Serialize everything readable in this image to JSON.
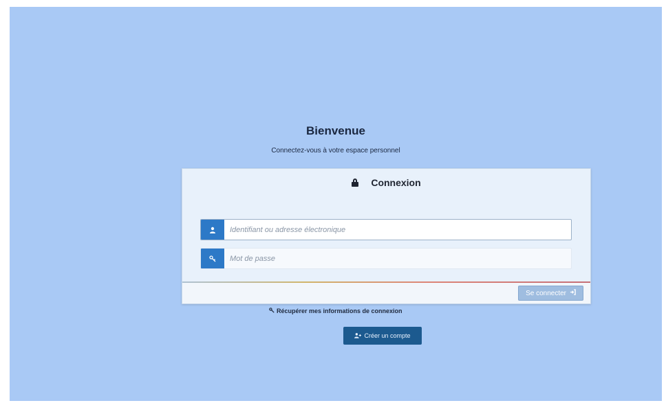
{
  "header": {
    "title": "Bienvenue",
    "subtitle": "Connectez-vous à votre espace personnel"
  },
  "panel": {
    "title": "Connexion",
    "title_icon": "lock-icon",
    "username": {
      "icon": "user-icon",
      "placeholder": "Identifiant ou adresse électronique",
      "value": ""
    },
    "password": {
      "icon": "key-icon",
      "placeholder": "Mot de passe",
      "value": ""
    },
    "login_button": {
      "label": "Se connecter",
      "icon": "sign-in-icon"
    }
  },
  "recover_link": {
    "label": "Récupérer mes informations de connexion",
    "icon": "key-icon"
  },
  "create_account_button": {
    "label": "Créer un compte",
    "icon": "user-plus-icon"
  },
  "colors": {
    "background": "#a9c9f5",
    "accent": "#2d79c7",
    "create_button": "#1c5a8f"
  }
}
